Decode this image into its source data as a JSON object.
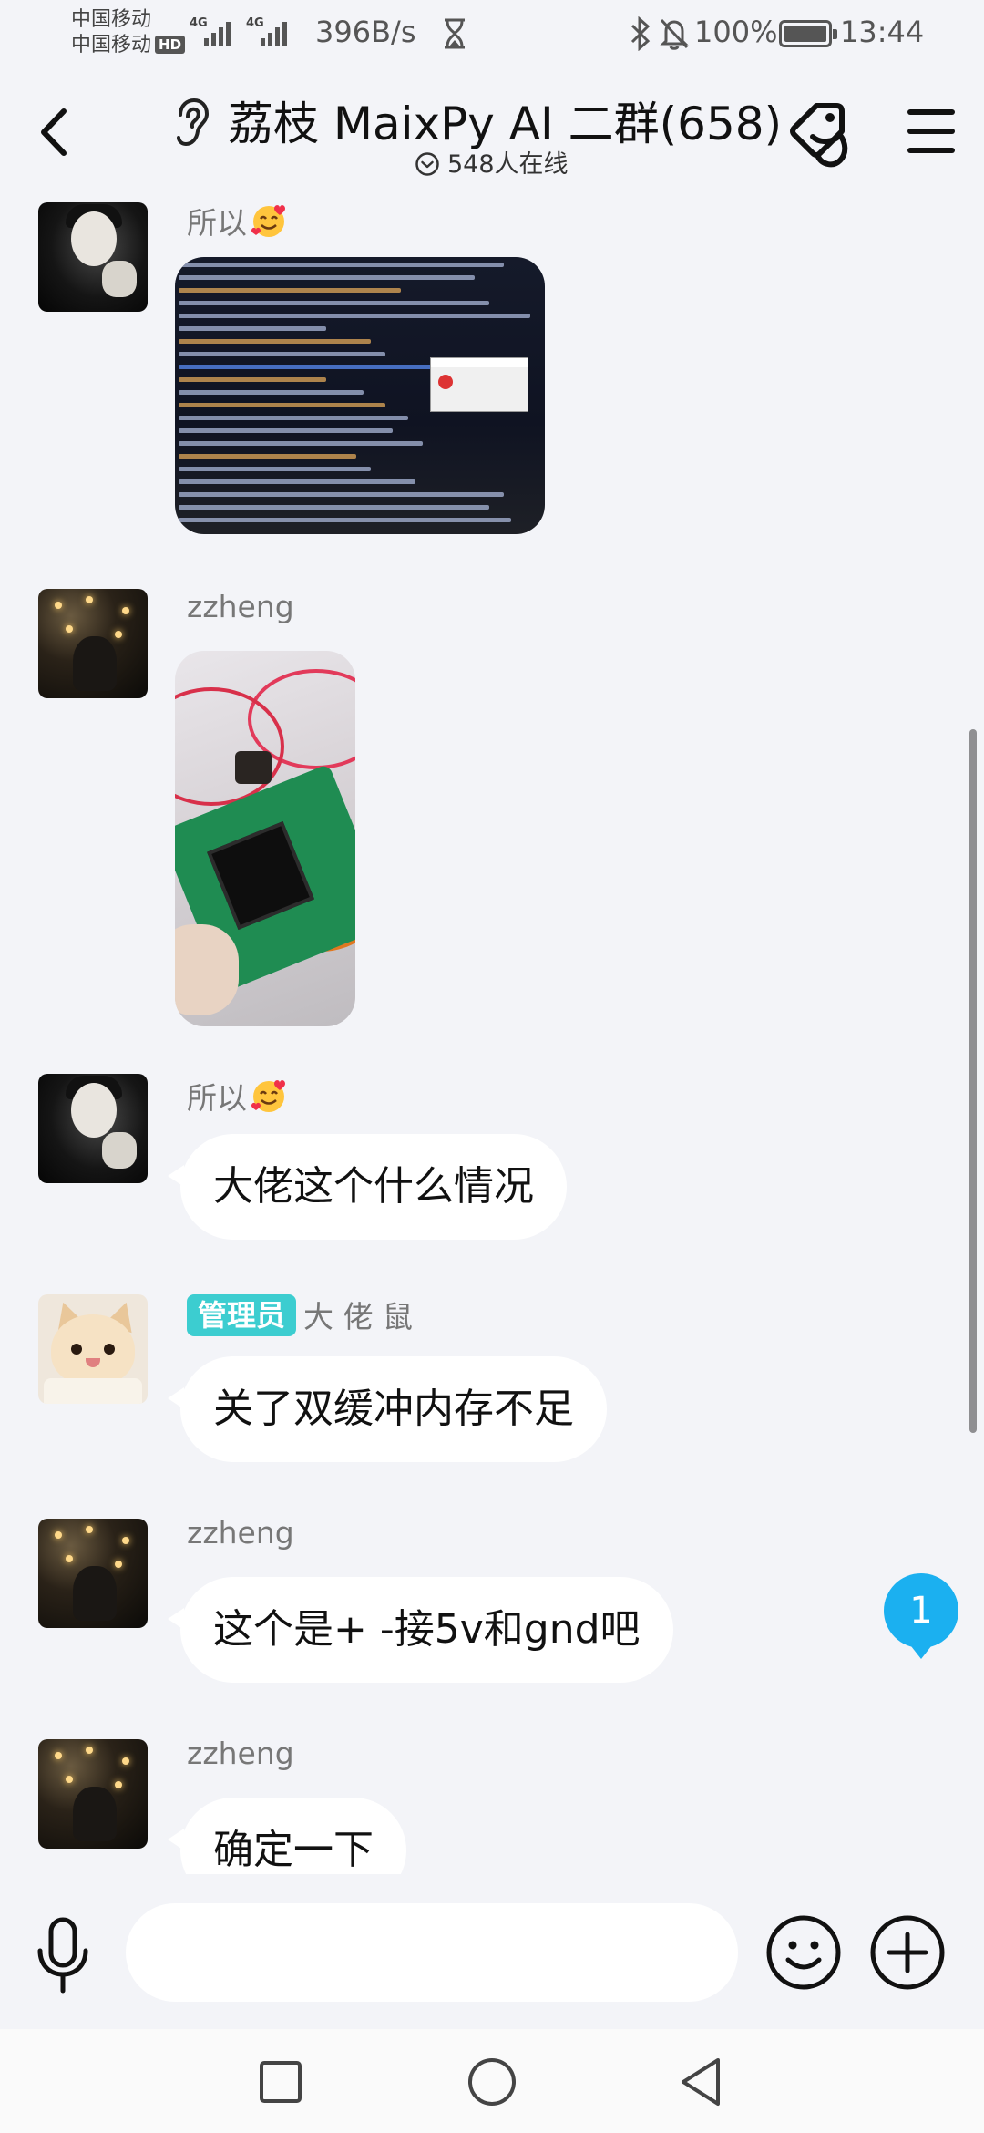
{
  "status_bar": {
    "carrier1": "中国移动",
    "carrier2": "中国移动",
    "hd": "HD",
    "net1": "4G",
    "net2": "4G",
    "net_speed": "396B/s",
    "battery_pct": "100%",
    "battery_level": 1.0,
    "time": "13:44",
    "icons": [
      "signal-icon",
      "hourglass-icon",
      "bluetooth-icon",
      "mute-icon",
      "battery-icon"
    ]
  },
  "header": {
    "title": "荔枝 MaixPy AI 二群(658)",
    "online": "548人在线",
    "icons": [
      "back-icon",
      "ear-icon",
      "tag-icon",
      "menu-icon"
    ]
  },
  "messages": [
    {
      "sender": "所以",
      "sender_emoji": "smiling-face-with-hearts-icon",
      "type": "image",
      "image_desc": "code-screenshot"
    },
    {
      "sender": "zzheng",
      "type": "image",
      "image_desc": "circuit-board-photo"
    },
    {
      "sender": "所以",
      "sender_emoji": "smiling-face-with-hearts-icon",
      "type": "text",
      "text": "大佬这个什么情况"
    },
    {
      "badge": "管理员",
      "sender": "大 佬 鼠",
      "type": "text",
      "text": "关了双缓冲内存不足"
    },
    {
      "sender": "zzheng",
      "type": "text",
      "text": "这个是+ -接5v和gnd吧"
    },
    {
      "sender": "zzheng",
      "type": "text",
      "text": "确定一下"
    }
  ],
  "unread_count": "1",
  "input": {
    "value": "",
    "placeholder": ""
  },
  "accent_color": "#1bb0f0",
  "admin_badge_color": "#3ccdd0",
  "nav_icons": [
    "recent-apps-icon",
    "home-icon",
    "back-nav-icon"
  ]
}
